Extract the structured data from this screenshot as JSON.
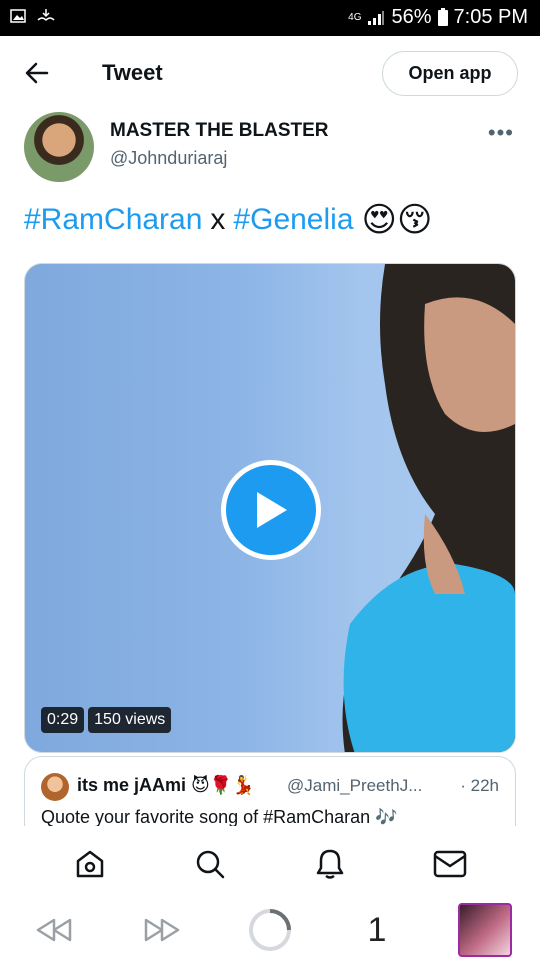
{
  "status_bar": {
    "network": "4G",
    "battery_percent": "56%",
    "time": "7:05 PM"
  },
  "header": {
    "title": "Tweet",
    "open_app_label": "Open app"
  },
  "tweet": {
    "author_name": "MASTER THE BLASTER",
    "author_handle": "@Johnduriaraj",
    "text_hashtag_1": "#RamCharan",
    "text_separator": "x",
    "text_hashtag_2": "#Genelia",
    "emojis": "😍😚",
    "video": {
      "duration": "0:29",
      "views": "150 views"
    }
  },
  "quoted_tweet": {
    "author_name": "its me jAAmi 😈🌹💃",
    "author_handle": "@Jami_PreethJ...",
    "time": "· 22h",
    "text": "Quote your favorite song of #RamCharan 🎶"
  },
  "browser_bar": {
    "tab_count": "1"
  },
  "colors": {
    "accent": "#1d9bf0",
    "text": "#0f1419",
    "secondary_text": "#536471",
    "border": "#cfd9de"
  },
  "icons": {
    "back": "arrow-left-icon",
    "more": "more-horizontal-icon",
    "play": "play-icon",
    "home": "home-icon",
    "search": "search-icon",
    "notifications": "bell-icon",
    "messages": "mail-icon",
    "browser_back": "rewind-icon",
    "browser_forward": "fast-forward-icon",
    "browser_reload": "loading-spinner-icon"
  }
}
